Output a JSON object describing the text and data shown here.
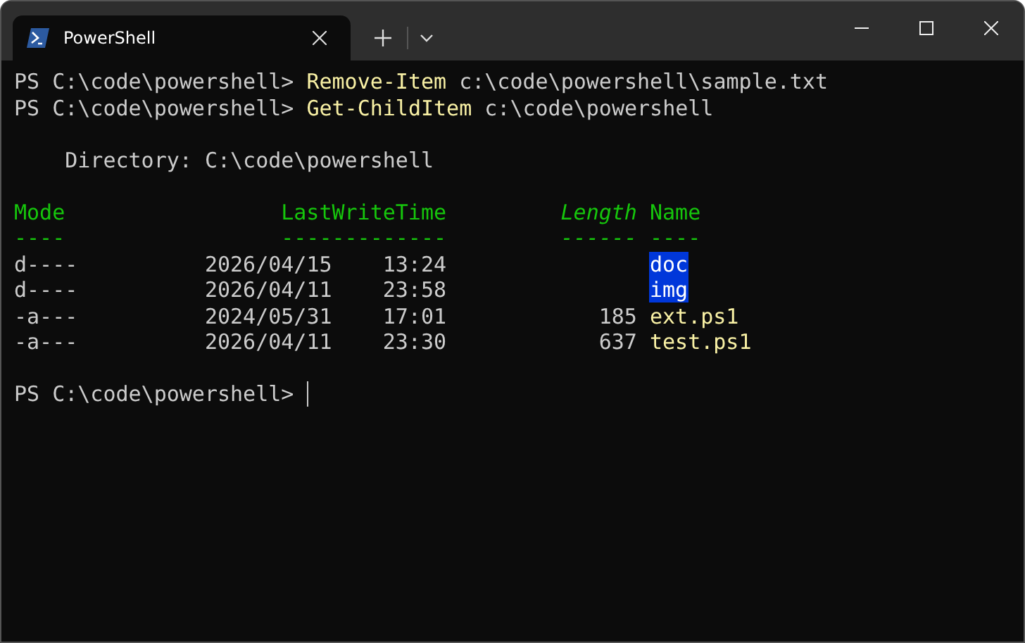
{
  "window": {
    "tabs": [
      {
        "title": "PowerShell",
        "selected": true
      }
    ]
  },
  "terminal": {
    "commands": [
      {
        "prompt": "PS C:\\code\\powershell>",
        "command": "Remove-Item",
        "argument": "c:\\code\\powershell\\sample.txt"
      },
      {
        "prompt": "PS C:\\code\\powershell>",
        "command": "Get-ChildItem",
        "argument": "c:\\code\\powershell"
      }
    ],
    "directory": "Directory: C:\\code\\powershell",
    "listing": {
      "columns": [
        {
          "label": "Mode",
          "underline": "----",
          "italic": false
        },
        {
          "label": "LastWriteTime",
          "underline": "-------------",
          "italic": false
        },
        {
          "label": "Length",
          "underline": "------",
          "italic": true
        },
        {
          "label": "Name",
          "underline": "----",
          "italic": false
        }
      ],
      "rows": [
        {
          "mode": "d----",
          "date": "2026/04/15",
          "time": "13:24",
          "name": "doc",
          "kind": "directory"
        },
        {
          "mode": "d----",
          "date": "2026/04/11",
          "time": "23:58",
          "name": "img",
          "kind": "directory"
        },
        {
          "mode": "-a---",
          "date": "2024/05/31",
          "time": "17:01",
          "length": "185",
          "name": "ext.ps1",
          "kind": "file"
        },
        {
          "mode": "-a---",
          "date": "2026/04/11",
          "time": "23:30",
          "length": "637",
          "name": "test.ps1",
          "kind": "file"
        }
      ]
    },
    "prompt": "PS C:\\code\\powershell>"
  }
}
